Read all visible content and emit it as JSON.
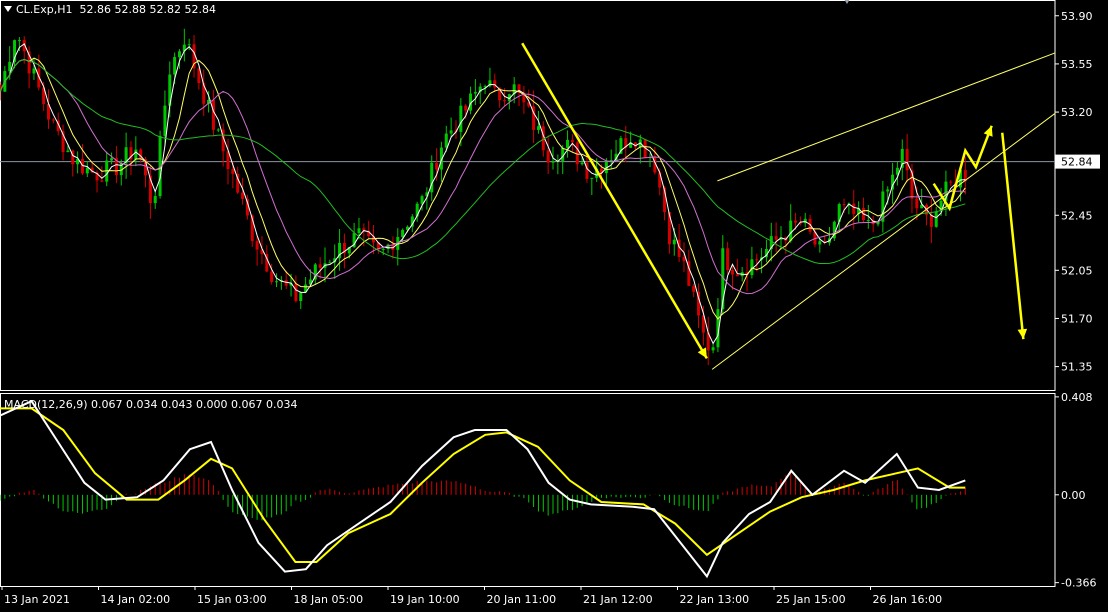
{
  "header": {
    "symbol": "CL.Exp,H1",
    "ohlc": "52.86 52.88 52.82 52.84"
  },
  "macd_label": "MACD(12,26,9) 0.067 0.034 0.043 0.000 0.067 0.034",
  "colors": {
    "background": "#000000",
    "bull": "#00c800",
    "bear": "#d40000",
    "ma_fast": "#ffffff",
    "ma_yellow": "#ffff66",
    "ma_violet": "#d070d0",
    "ma_green": "#22bb22",
    "macd_main": "#ffffff",
    "macd_signal": "#ffff00",
    "arrow": "#ffff00",
    "channel": "#ffff66",
    "price_line": "#8c96a0"
  },
  "chart_data": [
    {
      "type": "candlestick",
      "ylim": [
        51.18,
        54.0
      ],
      "y_ticks": [
        "53.90",
        "53.55",
        "53.20",
        "52.85",
        "52.45",
        "52.05",
        "51.70",
        "51.35"
      ],
      "current_price_label": "52.84",
      "current_price": 52.84,
      "x_labels": [
        "13 Jan 2021",
        "14 Jan 02:00",
        "15 Jan 03:00",
        "18 Jan 05:00",
        "19 Jan 10:00",
        "20 Jan 11:00",
        "21 Jan 12:00",
        "22 Jan 13:00",
        "25 Jan 15:00",
        "26 Jan 16:00"
      ],
      "close_path": [
        [
          0,
          53.35
        ],
        [
          0.015,
          53.8
        ],
        [
          0.03,
          53.5
        ],
        [
          0.05,
          53.1
        ],
        [
          0.07,
          52.85
        ],
        [
          0.09,
          52.75
        ],
        [
          0.11,
          52.8
        ],
        [
          0.13,
          52.95
        ],
        [
          0.145,
          52.5
        ],
        [
          0.16,
          53.5
        ],
        [
          0.175,
          53.75
        ],
        [
          0.19,
          53.4
        ],
        [
          0.205,
          53.05
        ],
        [
          0.22,
          52.75
        ],
        [
          0.24,
          52.3
        ],
        [
          0.26,
          52.0
        ],
        [
          0.28,
          51.85
        ],
        [
          0.3,
          52.05
        ],
        [
          0.32,
          52.2
        ],
        [
          0.34,
          52.3
        ],
        [
          0.36,
          52.15
        ],
        [
          0.38,
          52.35
        ],
        [
          0.4,
          52.55
        ],
        [
          0.42,
          53.0
        ],
        [
          0.44,
          53.2
        ],
        [
          0.46,
          53.45
        ],
        [
          0.47,
          53.3
        ],
        [
          0.485,
          53.4
        ],
        [
          0.5,
          53.2
        ],
        [
          0.52,
          52.9
        ],
        [
          0.54,
          52.95
        ],
        [
          0.56,
          52.75
        ],
        [
          0.58,
          52.9
        ],
        [
          0.6,
          53.05
        ],
        [
          0.62,
          52.85
        ],
        [
          0.635,
          52.3
        ],
        [
          0.65,
          52.05
        ],
        [
          0.665,
          51.6
        ],
        [
          0.675,
          51.45
        ],
        [
          0.685,
          52.15
        ],
        [
          0.7,
          52.05
        ],
        [
          0.72,
          52.15
        ],
        [
          0.74,
          52.3
        ],
        [
          0.76,
          52.4
        ],
        [
          0.78,
          52.15
        ],
        [
          0.795,
          52.5
        ],
        [
          0.81,
          52.45
        ],
        [
          0.825,
          52.35
        ],
        [
          0.84,
          52.6
        ],
        [
          0.855,
          52.9
        ],
        [
          0.865,
          52.55
        ],
        [
          0.88,
          52.4
        ],
        [
          0.895,
          52.6
        ],
        [
          0.91,
          52.75
        ]
      ],
      "annotations": {
        "arrows": [
          [
            [
              0.495,
              53.7
            ],
            [
              0.67,
              51.41
            ]
          ],
          [
            [
              0.885,
              52.68
            ],
            [
              0.9,
              52.5
            ],
            [
              0.915,
              52.92
            ],
            [
              0.925,
              52.8
            ],
            [
              0.94,
              53.1
            ]
          ],
          [
            [
              0.95,
              53.05
            ],
            [
              0.1025,
              51.55
            ]
          ]
        ],
        "channel_upper": [
          [
            0.68,
            52.7
          ],
          [
            1.0,
            53.63
          ]
        ],
        "channel_lower": [
          [
            0.675,
            51.33
          ],
          [
            1.0,
            53.19
          ]
        ]
      }
    },
    {
      "type": "macd",
      "y_ticks": [
        "0.408",
        "0.00",
        "-0.366"
      ],
      "ylim": [
        -0.38,
        0.42
      ],
      "macd_path": [
        [
          0,
          0.33
        ],
        [
          0.03,
          0.39
        ],
        [
          0.055,
          0.22
        ],
        [
          0.08,
          0.05
        ],
        [
          0.1,
          -0.02
        ],
        [
          0.13,
          -0.01
        ],
        [
          0.155,
          0.06
        ],
        [
          0.18,
          0.19
        ],
        [
          0.2,
          0.22
        ],
        [
          0.22,
          0.02
        ],
        [
          0.245,
          -0.2
        ],
        [
          0.27,
          -0.32
        ],
        [
          0.29,
          -0.31
        ],
        [
          0.31,
          -0.21
        ],
        [
          0.34,
          -0.12
        ],
        [
          0.37,
          -0.03
        ],
        [
          0.4,
          0.12
        ],
        [
          0.43,
          0.24
        ],
        [
          0.45,
          0.27
        ],
        [
          0.48,
          0.27
        ],
        [
          0.5,
          0.19
        ],
        [
          0.52,
          0.05
        ],
        [
          0.54,
          -0.02
        ],
        [
          0.56,
          -0.04
        ],
        [
          0.6,
          -0.05
        ],
        [
          0.62,
          -0.06
        ],
        [
          0.645,
          -0.2
        ],
        [
          0.67,
          -0.34
        ],
        [
          0.685,
          -0.2
        ],
        [
          0.71,
          -0.08
        ],
        [
          0.73,
          -0.03
        ],
        [
          0.75,
          0.1
        ],
        [
          0.77,
          0.0
        ],
        [
          0.8,
          0.1
        ],
        [
          0.82,
          0.05
        ],
        [
          0.85,
          0.17
        ],
        [
          0.87,
          0.03
        ],
        [
          0.89,
          0.02
        ],
        [
          0.915,
          0.06
        ]
      ],
      "signal_path": [
        [
          0,
          0.36
        ],
        [
          0.03,
          0.36
        ],
        [
          0.06,
          0.27
        ],
        [
          0.09,
          0.09
        ],
        [
          0.12,
          -0.02
        ],
        [
          0.15,
          -0.02
        ],
        [
          0.175,
          0.06
        ],
        [
          0.2,
          0.15
        ],
        [
          0.22,
          0.11
        ],
        [
          0.25,
          -0.1
        ],
        [
          0.28,
          -0.28
        ],
        [
          0.3,
          -0.28
        ],
        [
          0.33,
          -0.16
        ],
        [
          0.37,
          -0.08
        ],
        [
          0.4,
          0.05
        ],
        [
          0.43,
          0.17
        ],
        [
          0.46,
          0.25
        ],
        [
          0.48,
          0.26
        ],
        [
          0.51,
          0.2
        ],
        [
          0.54,
          0.06
        ],
        [
          0.57,
          -0.03
        ],
        [
          0.61,
          -0.04
        ],
        [
          0.64,
          -0.12
        ],
        [
          0.67,
          -0.25
        ],
        [
          0.7,
          -0.16
        ],
        [
          0.73,
          -0.07
        ],
        [
          0.76,
          -0.01
        ],
        [
          0.79,
          0.02
        ],
        [
          0.82,
          0.06
        ],
        [
          0.85,
          0.09
        ],
        [
          0.87,
          0.11
        ],
        [
          0.9,
          0.03
        ],
        [
          0.915,
          0.03
        ]
      ]
    }
  ]
}
